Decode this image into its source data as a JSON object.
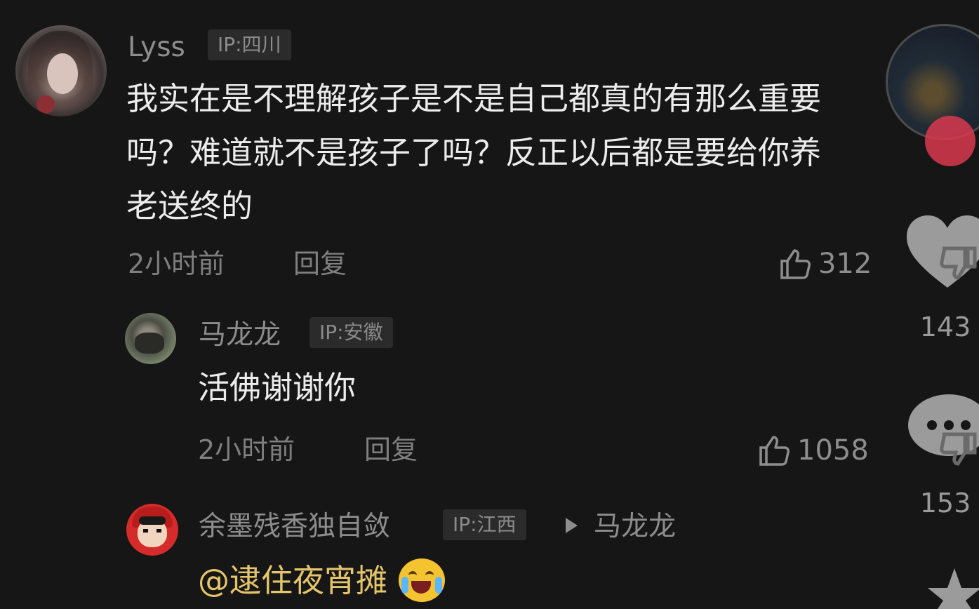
{
  "comments": [
    {
      "username": "Lyss",
      "ip_tag": "IP:四川",
      "text_lines": [
        "我实在是不理解孩子是不是自己都真的有那么重要",
        "吗？难道就不是孩子了吗？反正以后都是要给你养",
        "老送终的"
      ],
      "time": "2小时前",
      "reply_label": "回复",
      "likes": "312"
    },
    {
      "username": "马龙龙",
      "ip_tag": "IP:安徽",
      "text": "活佛谢谢你",
      "time": "2小时前",
      "reply_label": "回复",
      "likes": "1058"
    },
    {
      "username": "余墨残香独自敛",
      "ip_tag": "IP:江西",
      "reply_to": "马龙龙",
      "mention": "@逮住夜宵摊",
      "emoji": "crying-laughing-emoji"
    }
  ],
  "side_panel": {
    "heart_count": "143",
    "comment_count": "153"
  },
  "colors": {
    "background": "#161616",
    "mention": "#e4c56b",
    "muted": "#8d8d8d"
  }
}
